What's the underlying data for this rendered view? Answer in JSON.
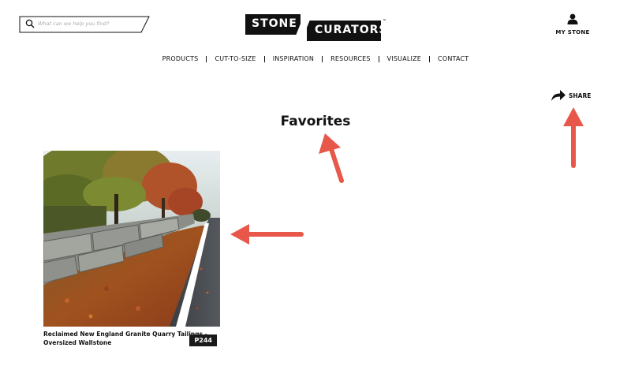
{
  "search": {
    "placeholder": "What can we help you find?"
  },
  "logo": {
    "word1": "STONE",
    "word2": "CURATORS",
    "mark": "™"
  },
  "account": {
    "label": "MY STONE",
    "icon": "user-icon"
  },
  "nav": {
    "items": [
      "PRODUCTS",
      "CUT-TO-SIZE",
      "INSPIRATION",
      "RESOURCES",
      "VISUALIZE",
      "CONTACT"
    ]
  },
  "share": {
    "label": "SHARE",
    "icon": "share-arrow-icon"
  },
  "page": {
    "title": "Favorites"
  },
  "favorites": [
    {
      "code": "P244",
      "name": "Reclaimed New England Granite Quarry Tailings - Oversized Wallstone"
    }
  ],
  "colors": {
    "annotation_arrow": "#e8584a",
    "brand": "#111111"
  }
}
